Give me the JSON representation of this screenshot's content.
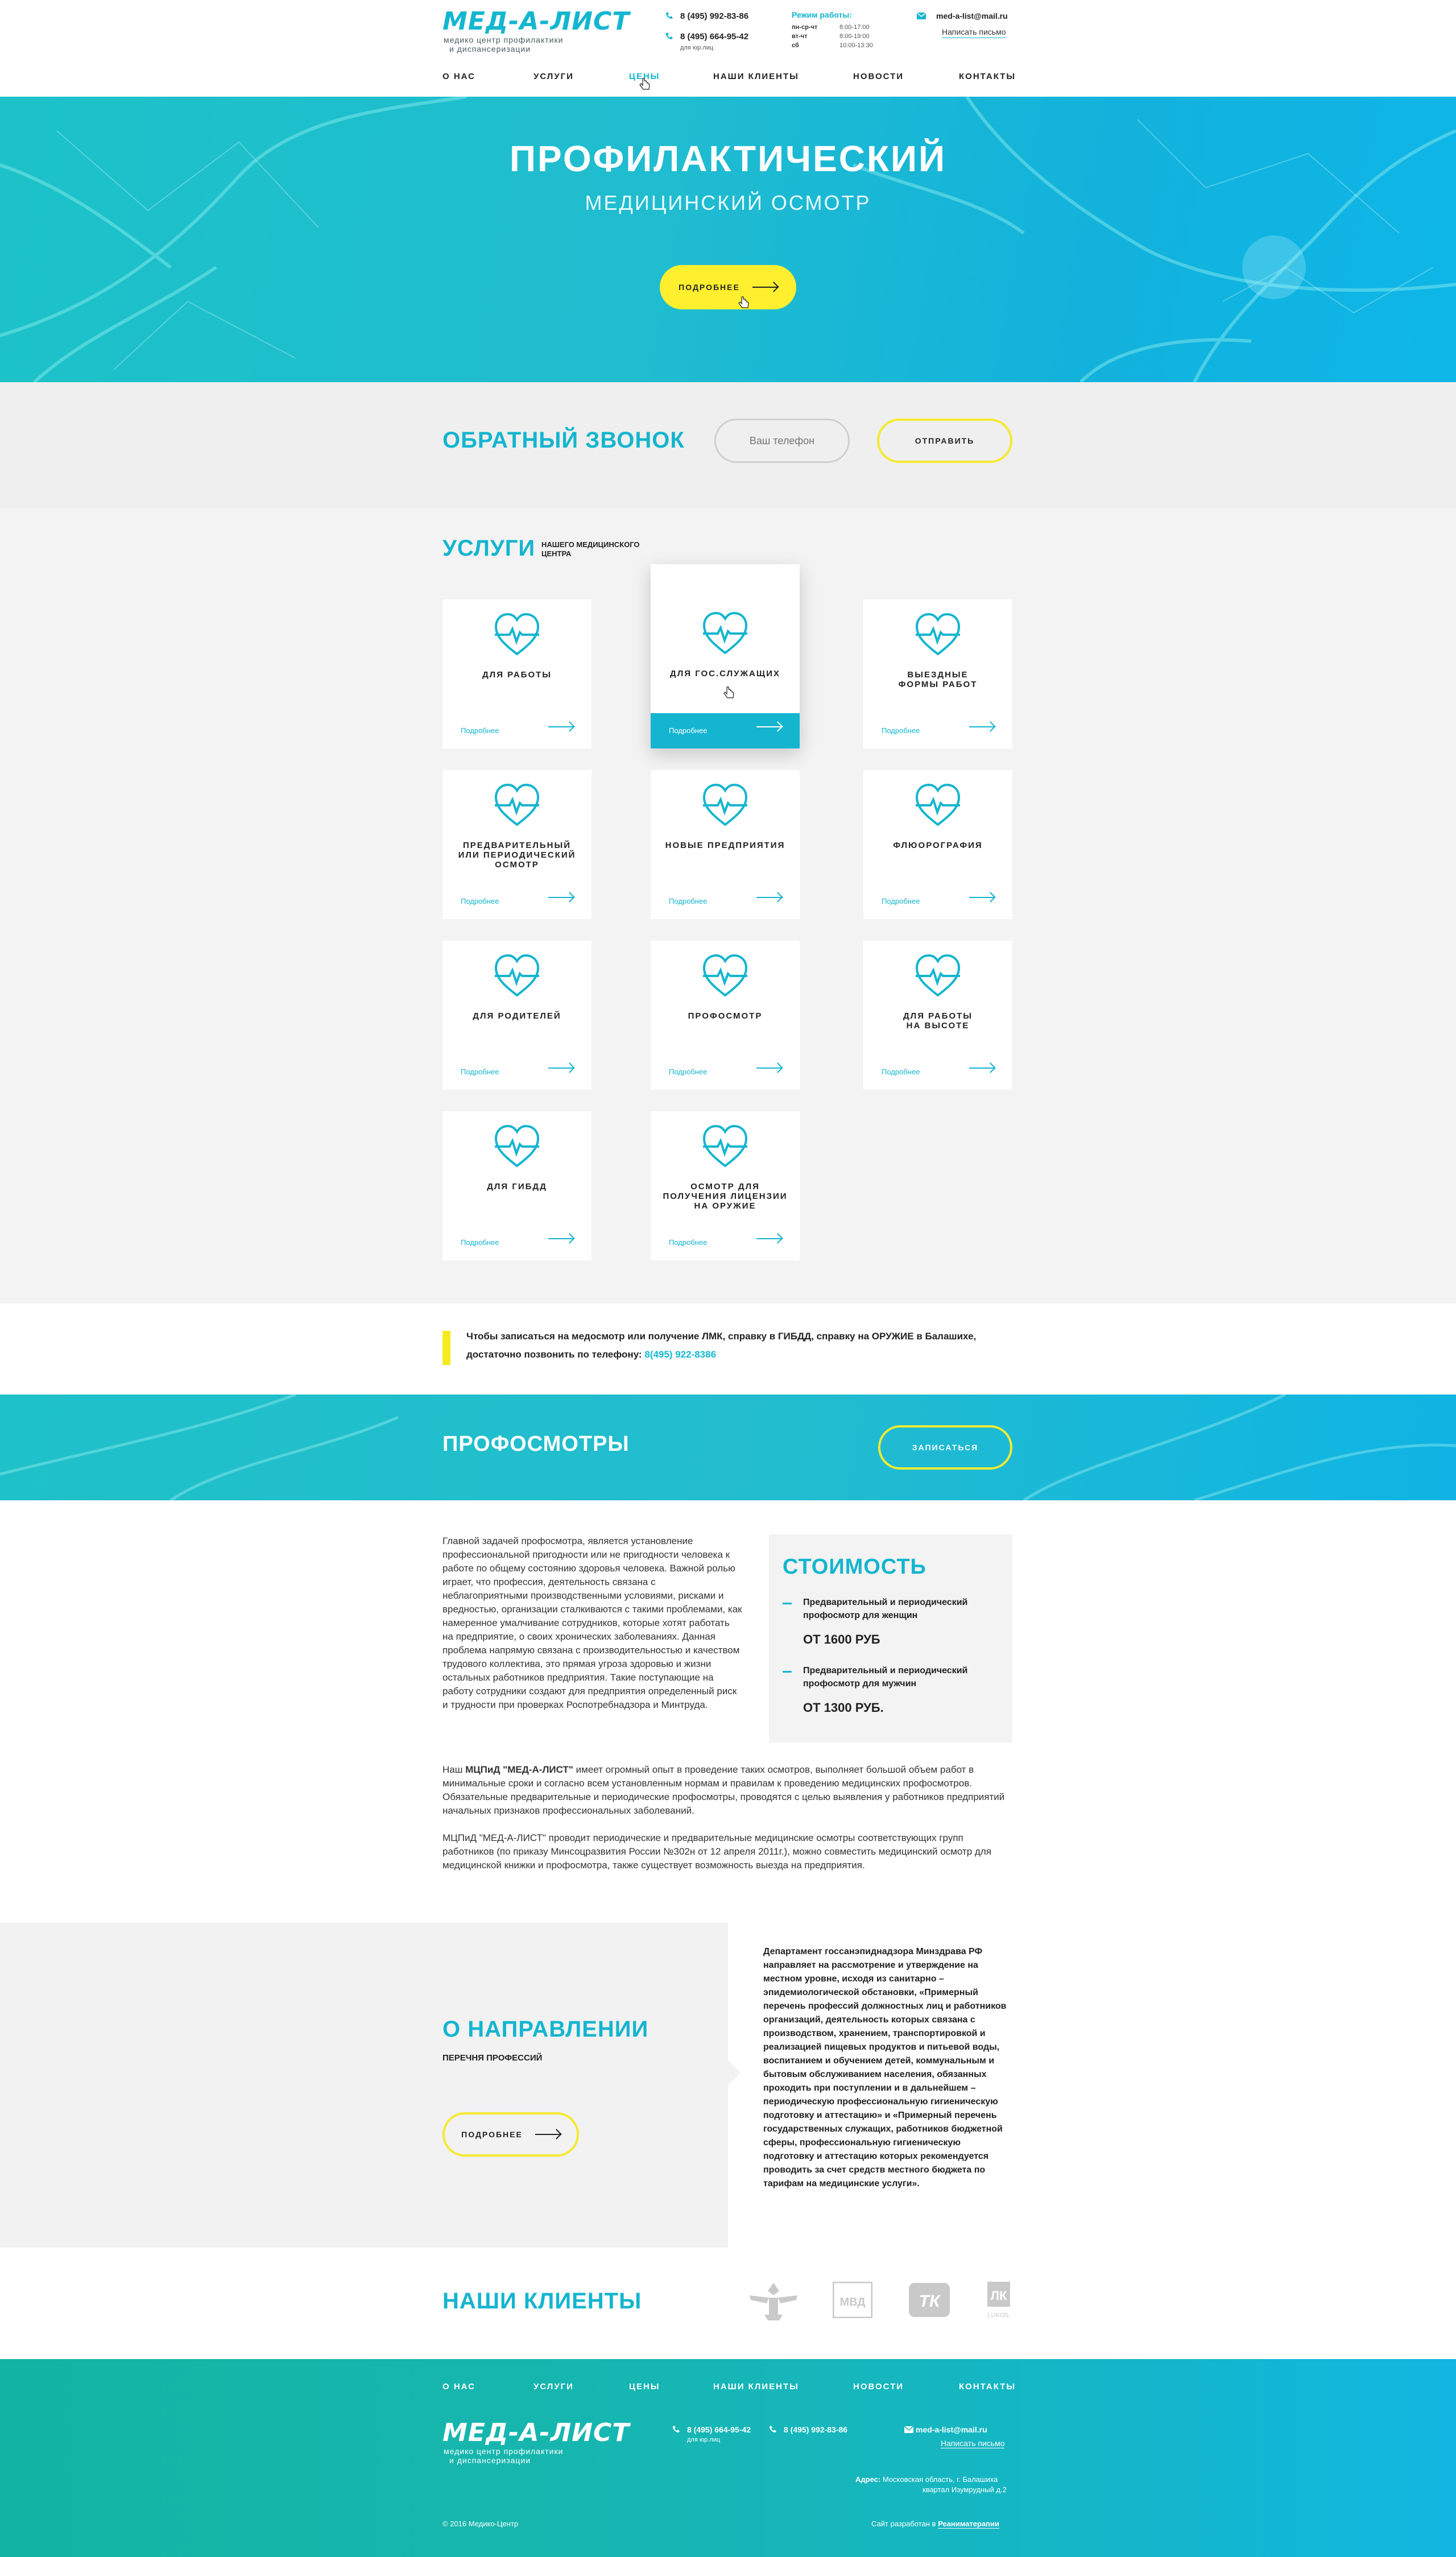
{
  "header": {
    "logo": "МЕД-А-ЛИСТ",
    "logo_sub1": "медико центр профилактики",
    "logo_sub2": "и диспансеризации",
    "phone1": "8 (495) 992-83-86",
    "phone2": "8 (495) 664-95-42",
    "phone2_note": "для юр.лиц",
    "hours_title": "Режим работы:",
    "hours": [
      {
        "d": "пн-ср-чт",
        "t": "8:00-17:00"
      },
      {
        "d": "вт-чт",
        "t": "8:00-19:00"
      },
      {
        "d": "сб",
        "t": "10:00-13:30"
      }
    ],
    "email": "med-a-list@mail.ru",
    "write": "Написать письмо"
  },
  "nav": [
    "О НАС",
    "УСЛУГИ",
    "ЦЕНЫ",
    "НАШИ КЛИЕНТЫ",
    "НОВОСТИ",
    "КОНТАКТЫ"
  ],
  "hero": {
    "title": "ПРОФИЛАКТИЧЕСКИЙ",
    "subtitle": "МЕДИЦИНСКИЙ ОСМОТР",
    "button": "ПОДРОБНЕЕ"
  },
  "callback": {
    "title": "ОБРАТНЫЙ ЗВОНОК",
    "placeholder": "Ваш телефон",
    "button": "ОТПРАВИТЬ"
  },
  "services": {
    "title": "УСЛУГИ",
    "sub1": "НАШЕГО МЕДИЦИНСКОГО",
    "sub2": "ЦЕНТРА",
    "more": "Подробнее",
    "cards": [
      {
        "l1": "ДЛЯ РАБОТЫ"
      },
      {
        "l1": "ДЛЯ ГОС.СЛУЖАЩИХ"
      },
      {
        "l1": "ВЫЕЗДНЫЕ",
        "l2": "ФОРМЫ РАБОТ"
      },
      {
        "l1": "ПРЕДВАРИТЕЛЬНЫЙ",
        "l2": "ИЛИ ПЕРИОДИЧЕСКИЙ",
        "l3": "ОСМОТР"
      },
      {
        "l1": "НОВЫЕ ПРЕДПРИЯТИЯ"
      },
      {
        "l1": "ФЛЮОРОГРАФИЯ"
      },
      {
        "l1": "ДЛЯ РОДИТЕЛЕЙ"
      },
      {
        "l1": "ПРОФОСМОТР"
      },
      {
        "l1": "ДЛЯ РАБОТЫ",
        "l2": "НА ВЫСОТЕ"
      },
      {
        "l1": "ДЛЯ ГИБДД"
      },
      {
        "l1": "ОСМОТР ДЛЯ",
        "l2": "ПОЛУЧЕНИЯ ЛИЦЕНЗИИ",
        "l3": "НА ОРУЖИЕ"
      }
    ]
  },
  "note": {
    "line1": "Чтобы записаться на медосмотр или получение ЛМК, справку в ГИБДД, справку на ОРУЖИЕ в Балашихе,",
    "line2": "достаточно позвонить по телефону:",
    "phone": "8(495) 922-8386"
  },
  "prof": {
    "title": "ПРОФОСМОТРЫ",
    "button": "ЗАПИСАТЬСЯ"
  },
  "content": {
    "p1": "Главной задачей профосмотра, является установление профессиональной пригодности или не пригодности человека к работе по общему состоянию здоровья человека. Важной ролью играет, что профессия, деятельность связана с неблагоприятными производственными условиями, рисками и вредностью, организации сталкиваются с такими проблемами, как намеренное умалчивание сотрудников, которые хотят работать на предприятие, о своих хронических заболеваниях. Данная проблема напрямую связана с производительностью и качеством трудового коллектива, это прямая угроза здоровью и жизни остальных работников предприятия. Такие поступающие на работу сотрудники создают для предприятия определенный риск и трудности при проверках Роспотребнадзора и Минтруда.",
    "p2a": "Наш ",
    "p2b": "МЦПиД \"МЕД-А-ЛИСТ\"",
    "p2c": " имеет огромный опыт в проведение таких осмотров, выполняет большой объем работ в минимальные сроки и согласно всем установленным нормам и правилам к проведению медицинских профосмотров. Обязательные предварительные и периодические профосмотры, проводятся с целью выявления у работников предприятий начальных признаков профессиональных заболеваний.",
    "p3": "МЦПиД \"МЕД-А-ЛИСТ\" проводит периодические и предварительные медицинские осмотры соответствующих групп работников (по приказу Минсоцразвития России №302н от 12 апреля 2011г.), можно совместить медицинский осмотр для медицинской книжки и профосмотра, также существует возможность выезда на предприятия."
  },
  "price": {
    "title": "СТОИМОСТЬ",
    "items": [
      {
        "name": "Предварительный и периодический профосмотр для женщин",
        "value": "ОТ 1600 РУБ"
      },
      {
        "name": "Предварительный и периодический профосмотр для мужчин",
        "value": "ОТ 1300 РУБ."
      }
    ]
  },
  "direction": {
    "title": "О НАПРАВЛЕНИИ",
    "sub": "ПЕРЕЧНЯ ПРОФЕССИЙ",
    "button": "ПОДРОБНЕЕ",
    "text": "Департамент госсанэпиднадзора Минздрава РФ направляет на рассмотрение и утверждение на местном уровне, исходя из санитарно – эпидемиологической обстановки, «Примерный перечень профессий должностных лиц и работников организаций, деятельность которых связана с производством, хранением, транспортировкой и реализацией пищевых продуктов и питьевой воды, воспитанием и обучением детей, коммунальным и бытовым обслуживанием населения, обязанных проходить при поступлении и в дальнейшем – периодическую профессиональную гигиеническую подготовку и аттестацию» и «Примерный перечень государственных служащих, работников бюджетной сферы, профессиональную гигиеническую подготовку и аттестацию которых рекомендуется проводить за счет средств местного бюджета по тарифам на медицинские услуги»."
  },
  "clients": {
    "title": "НАШИ КЛИЕНТЫ",
    "logos": [
      "emblem-logo",
      "МВД",
      "ТК",
      "LUKOIL"
    ]
  },
  "footer": {
    "nav": [
      "О НАС",
      "УСЛУГИ",
      "ЦЕНЫ",
      "НАШИ КЛИЕНТЫ",
      "НОВОСТИ",
      "КОНТАКТЫ"
    ],
    "logo": "МЕД-А-ЛИСТ",
    "logo_sub1": "медико центр профилактики",
    "logo_sub2": "и диспансеризации",
    "phone1": "8 (495) 664-95-42",
    "phone1_note": "для юр.лиц",
    "phone2": "8 (495) 992-83-86",
    "email": "med-a-list@mail.ru",
    "write": "Написать письмо",
    "address_label": "Адрес:",
    "address1": "Московская область, г. Балашиха",
    "address2": "квартал Изумрудный д.2",
    "copyright": "© 2016 Медико-Центр",
    "dev_pre": "Сайт разработан в ",
    "dev": "Реаниматерапии"
  },
  "colors": {
    "accent": "#13b5cf",
    "yellow": "#ffef2e"
  }
}
